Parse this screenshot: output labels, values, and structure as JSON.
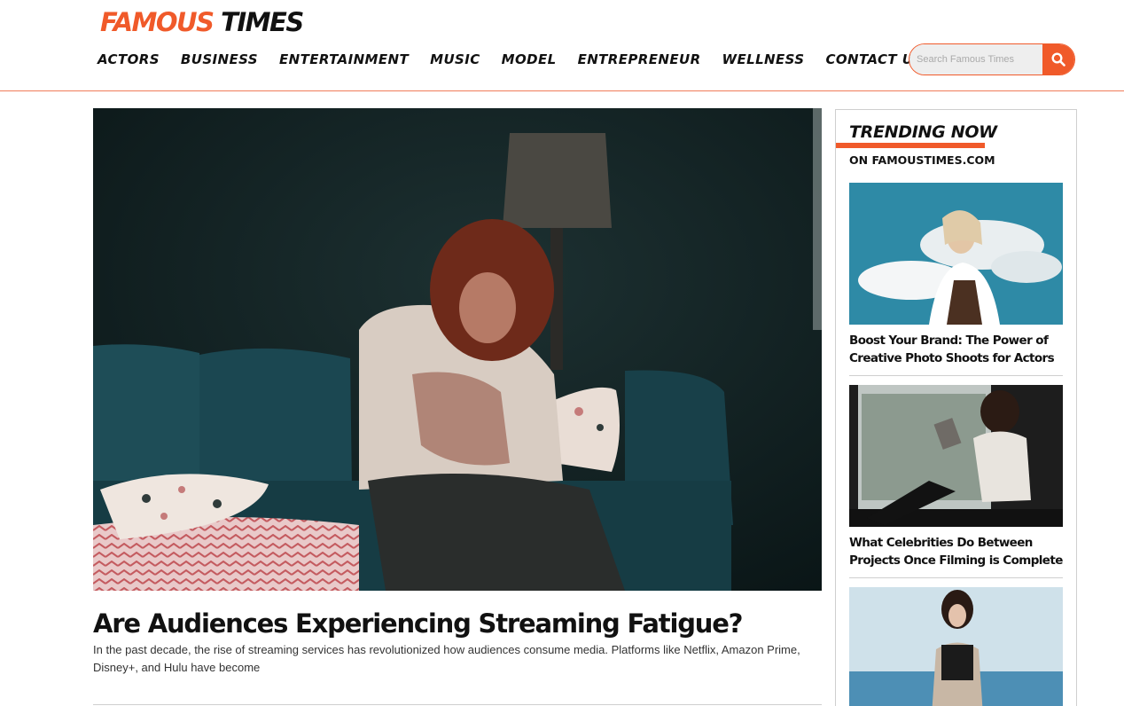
{
  "site": {
    "logo_part1": "FAMOUS",
    "logo_part2": "TIMES",
    "brand_color": "#f05a2a"
  },
  "nav": {
    "items": [
      "ACTORS",
      "BUSINESS",
      "ENTERTAINMENT",
      "MUSIC",
      "MODEL",
      "ENTREPRENEUR",
      "WELLNESS",
      "CONTACT US"
    ]
  },
  "search": {
    "placeholder": "Search Famous Times",
    "icon": "search-icon"
  },
  "article": {
    "image_alt": "Woman sitting on a teal couch with her face in her hands",
    "headline": "Are Audiences Experiencing Streaming Fatigue?",
    "excerpt": "In the past decade, the rise of streaming services has revolutionized how audiences consume media. Platforms like Netflix, Amazon Prime, Disney+, and Hulu have become"
  },
  "sidebar": {
    "title": "TRENDING NOW",
    "subtitle": "ON FAMOUSTIMES.COM",
    "items": [
      {
        "title": "Boost Your Brand: The Power of Creative Photo Shoots for Actors"
      },
      {
        "title": "What Celebrities Do Between Projects Once Filming is Complete"
      },
      {
        "title": ""
      }
    ]
  }
}
